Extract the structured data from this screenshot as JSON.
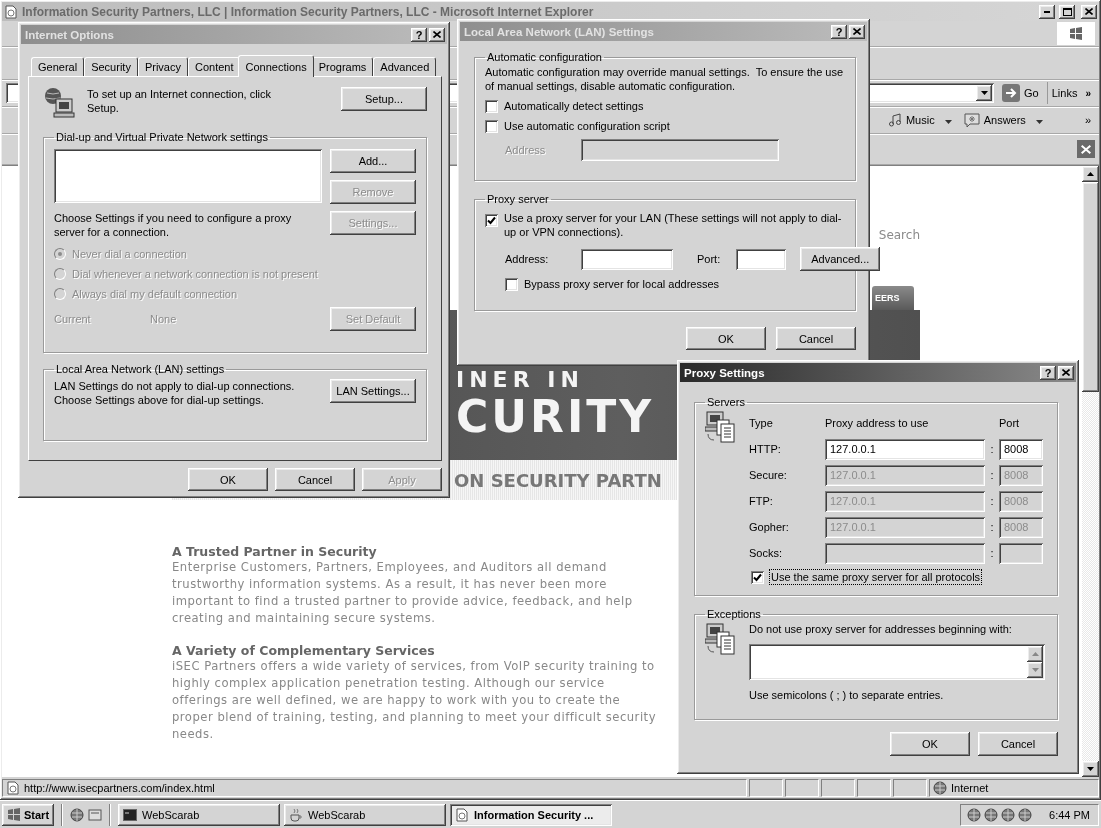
{
  "browser": {
    "title": "Information Security Partners, LLC | Information Security Partners, LLC - Microsoft Internet Explorer",
    "address_bar": {
      "go": "Go",
      "links": "Links",
      "links_more": "»"
    },
    "links_bar": {
      "items": [
        {
          "label": "Music"
        },
        {
          "label": "Answers"
        }
      ],
      "more": "»"
    },
    "page": {
      "search": "Search",
      "nav_tab": "EERS",
      "banner": [
        "INER IN",
        "CURITY"
      ],
      "strip": "ON SECURITY PARTN",
      "sections": [
        {
          "heading": "A Trusted Partner in Security",
          "body": "Enterprise Customers, Partners, Employees, and Auditors all demand trustworthy information systems. As a result, it has never been more important to find a trusted partner to provide advice, feedback, and help creating and maintaining secure systems."
        },
        {
          "heading": "A Variety of Complementary Services",
          "body": "iSEC Partners offers a wide variety of services, from VoIP security training to highly complex application penetration testing. Although our service offerings are well defined, we are happy to work with you to create the proper blend of training, testing, and planning to meet your difficult security needs."
        }
      ]
    },
    "status_bar": {
      "url": "http://www.isecpartners.com/index.html",
      "zone": "Internet"
    }
  },
  "internet_options": {
    "title": "Internet Options",
    "active": false,
    "help": "?",
    "tabs": [
      {
        "label": "General",
        "selected": false
      },
      {
        "label": "Security",
        "selected": false
      },
      {
        "label": "Privacy",
        "selected": false
      },
      {
        "label": "Content",
        "selected": false
      },
      {
        "label": "Connections",
        "selected": true
      },
      {
        "label": "Programs",
        "selected": false
      },
      {
        "label": "Advanced",
        "selected": false
      }
    ],
    "setup": {
      "text": "To set up an Internet connection, click Setup.",
      "button": "Setup..."
    },
    "dialup": {
      "legend": "Dial-up and Virtual Private Network settings",
      "buttons": [
        {
          "label": "Add...",
          "disabled": false
        },
        {
          "label": "Remove",
          "disabled": true
        }
      ],
      "hint": "Choose Settings if you need to configure a proxy server for a connection.",
      "settings_button": {
        "label": "Settings...",
        "disabled": true
      },
      "options": [
        {
          "label": "Never dial a connection",
          "selected": true,
          "disabled": true
        },
        {
          "label": "Dial whenever a network connection is not present",
          "selected": false,
          "disabled": true
        },
        {
          "label": "Always dial my default connection",
          "selected": false,
          "disabled": true
        }
      ],
      "current_label": "Current",
      "current_value": "None",
      "current_disabled": true,
      "set_default": {
        "label": "Set Default",
        "disabled": true
      }
    },
    "lan": {
      "legend": "Local Area Network (LAN) settings",
      "text": "LAN Settings do not apply to dial-up connections. Choose Settings above for dial-up settings.",
      "button": "LAN Settings..."
    },
    "footer": [
      {
        "label": "OK",
        "disabled": false
      },
      {
        "label": "Cancel",
        "disabled": false
      },
      {
        "label": "Apply",
        "disabled": true
      }
    ]
  },
  "lan_settings": {
    "title": "Local Area Network (LAN) Settings",
    "active": false,
    "help": "?",
    "auto": {
      "legend": "Automatic configuration",
      "text": "Automatic configuration may override manual settings.  To ensure the use of manual settings, disable automatic configuration.",
      "options": [
        {
          "label": "Automatically detect settings",
          "checked": false
        },
        {
          "label": "Use automatic configuration script",
          "checked": false
        }
      ],
      "address_label": "Address",
      "address_disabled": true
    },
    "proxy": {
      "legend": "Proxy server",
      "use_proxy": {
        "label": "Use a proxy server for your LAN (These settings will not apply to dial-up or VPN connections).",
        "checked": true
      },
      "address_label": "Address:",
      "port_label": "Port:",
      "advanced": "Advanced...",
      "bypass": {
        "label": "Bypass proxy server for local addresses",
        "checked": false
      }
    },
    "buttons": [
      "OK",
      "Cancel"
    ]
  },
  "proxy_settings": {
    "title": "Proxy Settings",
    "active": true,
    "help": "?",
    "servers": {
      "legend": "Servers",
      "headers": [
        "Type",
        "Proxy address to use",
        "Port"
      ],
      "rows": [
        {
          "type": "HTTP:",
          "address": "127.0.0.1",
          "separator": ":",
          "port": "8008",
          "disabled": false
        },
        {
          "type": "Secure:",
          "address": "127.0.0.1",
          "separator": ":",
          "port": "8008",
          "disabled": true
        },
        {
          "type": "FTP:",
          "address": "127.0.0.1",
          "separator": ":",
          "port": "8008",
          "disabled": true
        },
        {
          "type": "Gopher:",
          "address": "127.0.0.1",
          "separator": ":",
          "port": "8008",
          "disabled": true
        },
        {
          "type": "Socks:",
          "separator": ":",
          "disabled": true
        }
      ],
      "same_proxy": {
        "label": "Use the same proxy server for all protocols",
        "checked": true
      }
    },
    "exceptions": {
      "legend": "Exceptions",
      "text": "Do not use proxy server for addresses beginning with:",
      "note": "Use semicolons ( ; ) to separate entries."
    },
    "buttons": [
      "OK",
      "Cancel"
    ]
  },
  "taskbar": {
    "start": "Start",
    "tasks": [
      {
        "label": "WebScarab",
        "selected": false
      },
      {
        "label": "WebScarab",
        "selected": false
      },
      {
        "label": "Information Security ...",
        "selected": true
      }
    ],
    "clock": "6:44 PM"
  }
}
